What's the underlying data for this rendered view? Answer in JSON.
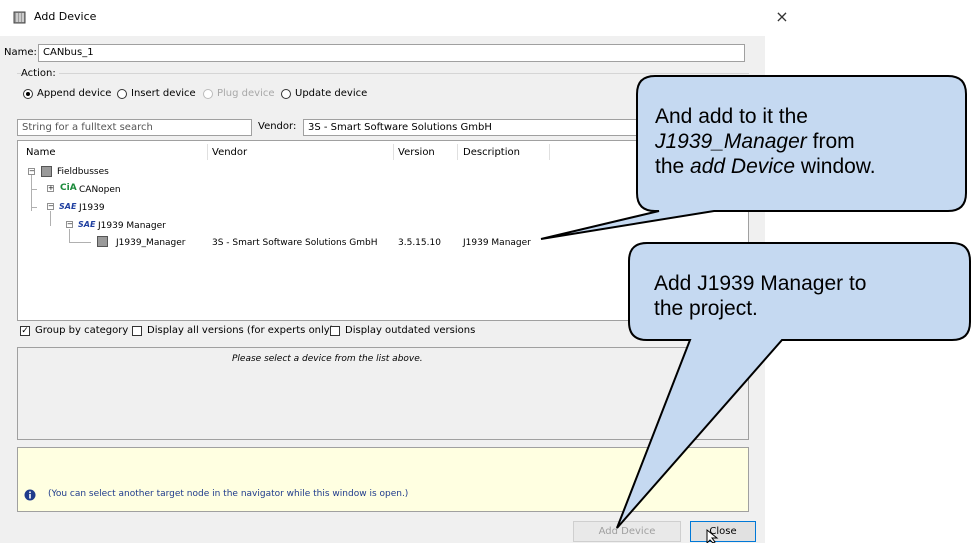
{
  "window": {
    "title": "Add Device",
    "close_glyph": "×"
  },
  "name_field": {
    "label": "Name:",
    "value": "CANbus_1"
  },
  "action": {
    "label": "Action:",
    "options": [
      {
        "label": "Append device",
        "selected": true,
        "enabled": true
      },
      {
        "label": "Insert device",
        "selected": false,
        "enabled": true
      },
      {
        "label": "Plug device",
        "selected": false,
        "enabled": false
      },
      {
        "label": "Update device",
        "selected": false,
        "enabled": true
      }
    ]
  },
  "search": {
    "placeholder": "String for a fulltext search"
  },
  "vendor": {
    "label": "Vendor:",
    "value": "3S - Smart Software Solutions GmbH"
  },
  "columns": [
    "Name",
    "Vendor",
    "Version",
    "Description"
  ],
  "tree": {
    "fieldbusses": "Fieldbusses",
    "canopen": "CANopen",
    "cia_logo": "CiA",
    "j1939": "J1939",
    "sae_logo": "SAE",
    "j1939_manager_group": "J1939 Manager",
    "device_row": {
      "name": "J1939_Manager",
      "vendor": "3S - Smart Software Solutions GmbH",
      "version": "3.5.15.10",
      "description": "J1939 Manager"
    }
  },
  "options": {
    "group_by_category": "Group by category",
    "display_all_versions": "Display all versions (for experts only)",
    "display_outdated": "Display outdated versions"
  },
  "info_text": "Please select a device from the list above.",
  "hint_text": "(You can select another target node in the navigator while this window is open.)",
  "buttons": {
    "add_device": "Add Device",
    "close": "Close"
  },
  "callouts": {
    "first": {
      "line1": "And add to it the",
      "line2_italic": "J1939_Manager",
      "line2_rest": " from",
      "line3_pre": "the ",
      "line3_italic": "add Device",
      "line3_post": " window."
    },
    "second": {
      "line1": "Add J1939 Manager to",
      "line2": "the project."
    }
  },
  "colors": {
    "callout_fill": "#c5d9f1",
    "callout_stroke": "#000000",
    "hint_icon": "#1f3b8c",
    "hint_text": "#1f3b8c",
    "note_bg": "#ffffe1"
  }
}
